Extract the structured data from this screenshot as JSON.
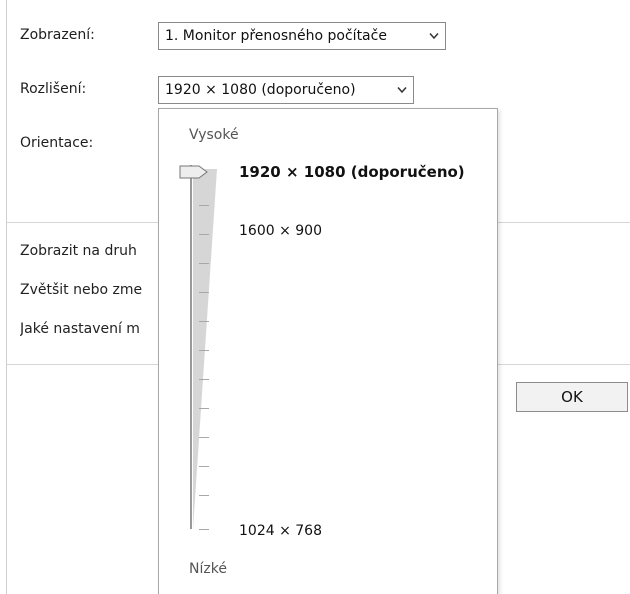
{
  "display": {
    "label": "Zobrazení:",
    "value": "1. Monitor přenosného počítače"
  },
  "resolution": {
    "label": "Rozlišení:",
    "value": "1920 × 1080 (doporučeno)"
  },
  "orientation": {
    "label": "Orientace:"
  },
  "links": [
    "Zobrazit na druh",
    "Zvětšit nebo zme",
    "Jaké nastavení m"
  ],
  "ok_label": "OK",
  "popup": {
    "high_label": "Vysoké",
    "low_label": "Nízké",
    "options": [
      "1920 × 1080 (doporučeno)",
      "1600 × 900",
      "1024 × 768"
    ],
    "slider_level_percent": 100
  }
}
